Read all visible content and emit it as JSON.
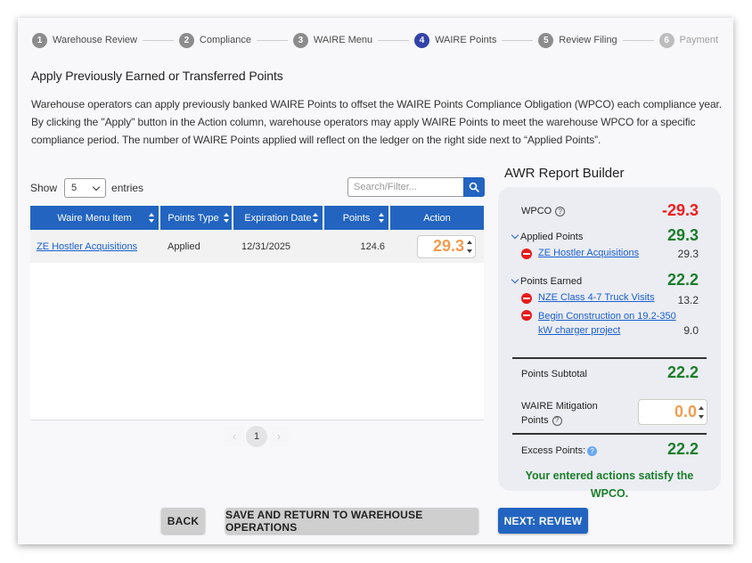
{
  "stepper": {
    "steps": [
      {
        "num": "1",
        "label": "Warehouse Review",
        "state": "complete"
      },
      {
        "num": "2",
        "label": "Compliance",
        "state": "complete"
      },
      {
        "num": "3",
        "label": "WAIRE Menu",
        "state": "complete"
      },
      {
        "num": "4",
        "label": "WAIRE Points",
        "state": "active"
      },
      {
        "num": "5",
        "label": "Review Filing",
        "state": "complete"
      },
      {
        "num": "6",
        "label": "Payment",
        "state": "disabled"
      }
    ]
  },
  "section": {
    "title": "Apply Previously Earned or Transferred Points",
    "description": "Warehouse operators can apply previously banked WAIRE Points to offset the WAIRE Points Compliance Obligation (WPCO) each compliance year. By clicking the \"Apply\" button in the Action column, warehouse operators may apply WAIRE Points to meet the warehouse WPCO for a specific compliance period. The number of WAIRE Points applied will reflect on the ledger on the right side next to “Applied Points”."
  },
  "table_controls": {
    "show_label": "Show",
    "entries_value": "5",
    "entries_label": "entries",
    "search_placeholder": "Search/Filter..."
  },
  "table": {
    "columns": [
      "Waire Menu Item",
      "Points Type",
      "Expiration Date",
      "Points",
      "Action"
    ],
    "rows": [
      {
        "item": "ZE Hostler Acquisitions",
        "type": "Applied",
        "expiration": "12/31/2025",
        "points": "124.6",
        "action_value": "29.3"
      }
    ]
  },
  "pagination": {
    "prev": "‹",
    "current": "1",
    "next": "›"
  },
  "report_builder": {
    "title": "AWR Report Builder",
    "wpco_label": "WPCO",
    "wpco_value": "-29.3",
    "applied_label": "Applied Points",
    "applied_total": "29.3",
    "applied_items": [
      {
        "name": "ZE Hostler Acquisitions",
        "value": "29.3"
      }
    ],
    "earned_label": "Points Earned",
    "earned_total": "22.2",
    "earned_items": [
      {
        "name_line1": "NZE Class 4-7 Truck Visits",
        "name_line2": "",
        "value": "13.2"
      },
      {
        "name_line1": "Begin Construction on 19.2-350",
        "name_line2": "kW charger project",
        "value": "9.0"
      }
    ],
    "subtotal_label": "Points Subtotal",
    "subtotal_value": "22.2",
    "mitigation_label_line1": "WAIRE Mitigation",
    "mitigation_label_line2": "Points",
    "mitigation_value": "0.0",
    "excess_label": "Excess Points:",
    "excess_value": "22.2",
    "message_line1": "Your entered actions satisfy the",
    "message_line2": "WPCO."
  },
  "buttons": {
    "back": "BACK",
    "save_return": "SAVE AND RETURN TO WAREHOUSE OPERATIONS",
    "next": "NEXT: REVIEW"
  },
  "colors": {
    "primary": "#2264c0",
    "active_step": "#3443a8",
    "negative": "#ee1c1c",
    "positive": "#1b7d2b",
    "input_value": "#f59b4f"
  }
}
